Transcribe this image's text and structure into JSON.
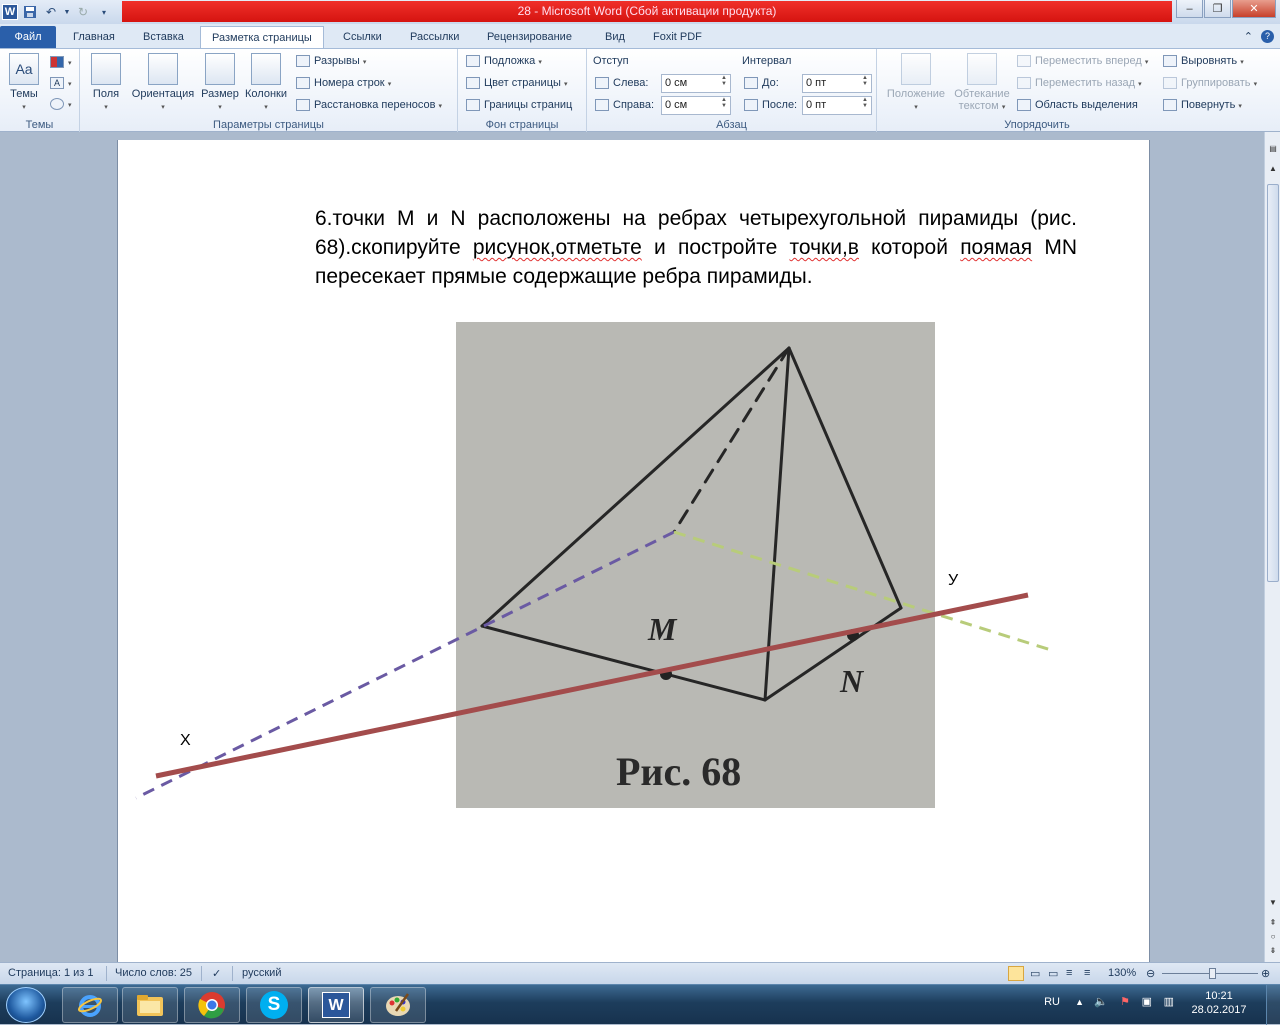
{
  "window": {
    "title": "28  -  Microsoft Word (Сбой активации продукта)"
  },
  "tabs": [
    {
      "label": "Файл"
    },
    {
      "label": "Главная"
    },
    {
      "label": "Вставка"
    },
    {
      "label": "Разметка страницы",
      "active": true
    },
    {
      "label": "Ссылки"
    },
    {
      "label": "Рассылки"
    },
    {
      "label": "Рецензирование"
    },
    {
      "label": "Вид"
    },
    {
      "label": "Foxit PDF"
    }
  ],
  "ribbon": {
    "themes": {
      "label": "Темы",
      "group": "Темы"
    },
    "page_setup": {
      "group": "Параметры страницы",
      "fields": "Поля",
      "orientation": "Ориентация",
      "size": "Размер",
      "columns": "Колонки",
      "breaks": "Разрывы",
      "line_numbers": "Номера строк",
      "hyphenation": "Расстановка переносов"
    },
    "page_background": {
      "group": "Фон страницы",
      "watermark": "Подложка",
      "page_color": "Цвет страницы",
      "page_borders": "Границы страниц"
    },
    "paragraph": {
      "group": "Абзац",
      "indent_title": "Отступ",
      "indent_left_label": "Слева:",
      "indent_left_value": "0 см",
      "indent_right_label": "Справа:",
      "indent_right_value": "0 см",
      "spacing_title": "Интервал",
      "spacing_before_label": "До:",
      "spacing_before_value": "0 пт",
      "spacing_after_label": "После:",
      "spacing_after_value": "0 пт"
    },
    "arrange": {
      "group": "Упорядочить",
      "position": "Положение",
      "wrap_l1": "Обтекание",
      "wrap_l2": "текстом",
      "bring_forward": "Переместить вперед",
      "send_backward": "Переместить назад",
      "selection_pane": "Область выделения",
      "align": "Выровнять",
      "group_btn": "Группировать",
      "rotate": "Повернуть"
    }
  },
  "document": {
    "text_p1": "6.точки М и N расположены на ребрах четырехугольной пирамиды (рис. 68).скопируйте ",
    "text_w1": "рисунок,отметьте",
    "text_p2": " и постройте ",
    "text_w2": "точки,в",
    "text_p3": " которой ",
    "text_w3": "поямая",
    "text_p4": " MN пересекает прямые содержащие ребра пирамиды.",
    "figure": {
      "label_m": "M",
      "label_n": "N",
      "caption": "Рис. 68",
      "label_x": "Х",
      "label_y": "У",
      "colors": {
        "photo_bg": "#b9b9b4",
        "red_line": "#a34c4c",
        "purple_dash": "#6a5aa3",
        "green_dash": "#b8cc7a"
      }
    }
  },
  "statusbar": {
    "page": "Страница: 1 из 1",
    "words": "Число слов: 25",
    "language": "русский",
    "zoom": "130%"
  },
  "taskbar": {
    "lang": "RU",
    "time": "10:21",
    "date": "28.02.2017"
  }
}
